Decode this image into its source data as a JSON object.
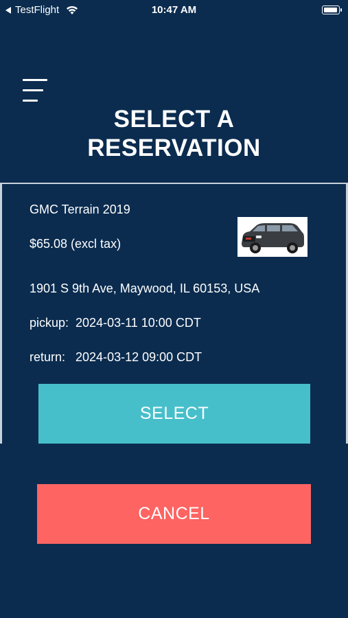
{
  "status_bar": {
    "carrier": "TestFlight",
    "time": "10:47 AM",
    "icons": [
      "back-arrow-icon",
      "wifi-icon",
      "battery-icon"
    ]
  },
  "header": {
    "menu_icon": "hamburger-menu-icon",
    "title": "SELECT A\nRESERVATION"
  },
  "reservation": {
    "vehicle": "GMC Terrain 2019",
    "price": "$65.08 (excl tax)",
    "address": "1901 S 9th Ave, Maywood, IL 60153, USA",
    "pickup": "pickup:  2024-03-11 10:00 CDT",
    "return": "return:   2024-03-12 09:00 CDT",
    "image": "car-photo"
  },
  "buttons": {
    "select_label": "SELECT",
    "cancel_label": "CANCEL"
  },
  "colors": {
    "background": "#0b2c4f",
    "select": "#47bfcb",
    "cancel": "#fd6462"
  }
}
